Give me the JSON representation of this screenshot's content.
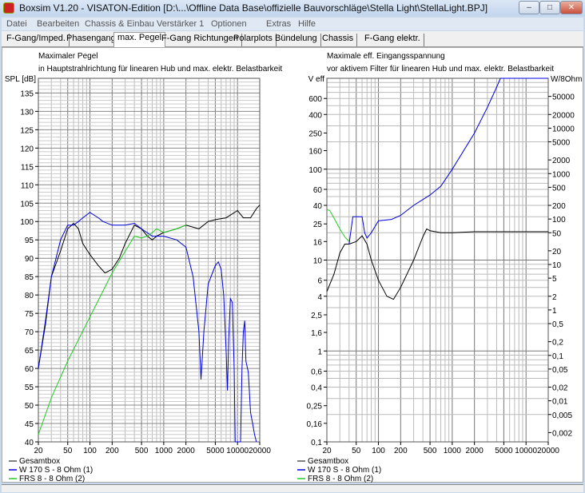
{
  "window": {
    "title": "Boxsim V1.20 - VISATON-Edition [D:\\...\\Offline Data Base\\offizielle Bauvorschläge\\Stella Light\\StellaLight.BPJ]",
    "min": "–",
    "max": "□",
    "close": "✕"
  },
  "menu": [
    "Datei",
    "Bearbeiten",
    "Chassis & Einbau",
    "Verstärker 1",
    "Optionen",
    "Extras",
    "Hilfe"
  ],
  "tabs": [
    "F-Gang/Imped.",
    "Phasengang",
    "max. Pegel",
    "F-Gang Richtungen",
    "Polarplots",
    "Bündelung",
    "Chassis",
    "F-Gang elektr."
  ],
  "active_tab": "max. Pegel",
  "colors": {
    "gesamt": "#000000",
    "woofer": "#0000dd",
    "frs": "#22cc22"
  },
  "chart_data": [
    {
      "type": "line",
      "title": "Maximaler Pegel",
      "subtitle": "in Hauptstrahlrichtung für linearen Hub und max. elektr. Belastbarkeit",
      "ylabel": "SPL [dB]",
      "xscale": "log",
      "xlim": [
        20,
        20000
      ],
      "ylim": [
        40,
        139
      ],
      "xticks": [
        20,
        50,
        100,
        200,
        500,
        1000,
        2000,
        5000,
        10000,
        20000
      ],
      "yticks": [
        40,
        45,
        50,
        55,
        60,
        65,
        70,
        75,
        80,
        85,
        90,
        95,
        100,
        105,
        110,
        115,
        120,
        125,
        130,
        135
      ],
      "legend": [
        "Gesamtbox",
        "W 170 S - 8 Ohm (1)",
        "FRS 8 - 8 Ohm (2)"
      ],
      "series": [
        {
          "name": "Gesamtbox",
          "color": "#000000",
          "points": [
            [
              20,
              60
            ],
            [
              25,
              72
            ],
            [
              30,
              85
            ],
            [
              40,
              92
            ],
            [
              50,
              98
            ],
            [
              60,
              99.5
            ],
            [
              70,
              98
            ],
            [
              80,
              94
            ],
            [
              100,
              91
            ],
            [
              130,
              88
            ],
            [
              160,
              86
            ],
            [
              200,
              87
            ],
            [
              250,
              90
            ],
            [
              300,
              94
            ],
            [
              400,
              99
            ],
            [
              500,
              98
            ],
            [
              600,
              96
            ],
            [
              700,
              95
            ],
            [
              800,
              96
            ],
            [
              1000,
              97
            ],
            [
              1500,
              98
            ],
            [
              2000,
              99
            ],
            [
              3000,
              98
            ],
            [
              4000,
              100
            ],
            [
              5000,
              100.5
            ],
            [
              7000,
              101
            ],
            [
              10000,
              103
            ],
            [
              12000,
              101
            ],
            [
              15000,
              101
            ],
            [
              18000,
              103.5
            ],
            [
              20000,
              104.5
            ]
          ]
        },
        {
          "name": "W 170 S - 8 Ohm (1)",
          "color": "#0000dd",
          "points": [
            [
              20,
              60
            ],
            [
              25,
              73
            ],
            [
              30,
              85
            ],
            [
              40,
              95
            ],
            [
              50,
              99
            ],
            [
              60,
              99
            ],
            [
              70,
              100
            ],
            [
              80,
              101
            ],
            [
              100,
              102.5
            ],
            [
              130,
              101
            ],
            [
              150,
              100
            ],
            [
              200,
              99
            ],
            [
              300,
              99
            ],
            [
              400,
              99.5
            ],
            [
              500,
              98
            ],
            [
              700,
              96
            ],
            [
              1000,
              96
            ],
            [
              1500,
              95
            ],
            [
              2000,
              93
            ],
            [
              2500,
              85
            ],
            [
              3000,
              70
            ],
            [
              3200,
              57
            ],
            [
              3500,
              70
            ],
            [
              4000,
              83
            ],
            [
              5000,
              88
            ],
            [
              5500,
              89
            ],
            [
              6000,
              87
            ],
            [
              6500,
              80
            ],
            [
              7000,
              65
            ],
            [
              7300,
              54
            ],
            [
              7600,
              68
            ],
            [
              8000,
              79
            ],
            [
              8500,
              78
            ],
            [
              9000,
              60
            ],
            [
              9300,
              40
            ],
            [
              11000,
              40
            ],
            [
              11500,
              60
            ],
            [
              12000,
              70
            ],
            [
              12500,
              73
            ],
            [
              13000,
              62
            ],
            [
              14000,
              59
            ],
            [
              15000,
              48
            ],
            [
              16000,
              45
            ],
            [
              17000,
              42
            ],
            [
              18000,
              40
            ]
          ]
        },
        {
          "name": "FRS 8 - 8 Ohm (2)",
          "color": "#22cc22",
          "points": [
            [
              20,
              42
            ],
            [
              30,
              52
            ],
            [
              50,
              62
            ],
            [
              100,
              74
            ],
            [
              200,
              86
            ],
            [
              400,
              96
            ],
            [
              500,
              95.5
            ],
            [
              600,
              96
            ],
            [
              700,
              97
            ],
            [
              800,
              98
            ],
            [
              1000,
              97
            ],
            [
              1500,
              98
            ],
            [
              2000,
              99
            ]
          ]
        }
      ]
    },
    {
      "type": "line",
      "title": "Maximale eff. Eingangsspannung",
      "subtitle": "vor aktivem Filter für linearen Hub und max. elektr. Belastbarkeit",
      "ylabel": "V eff",
      "y2label": "W/8Ohm",
      "xscale": "log",
      "yscale": "log",
      "xlim": [
        20,
        20000
      ],
      "ylim": [
        0.1,
        1000
      ],
      "xticks": [
        20,
        50,
        100,
        200,
        500,
        1000,
        2000,
        5000,
        10000,
        20000
      ],
      "yticks": [
        "600",
        "400",
        "250",
        "160",
        "100",
        "60",
        "40",
        "25",
        "16",
        "10",
        "6",
        "4",
        "2,5",
        "1,6",
        "1",
        "0,6",
        "0,4",
        "0,25",
        "0,16",
        "0,1"
      ],
      "y2ticks": [
        "50000",
        "20000",
        "10000",
        "5000",
        "2000",
        "1000",
        "500",
        "200",
        "100",
        "50",
        "20",
        "10",
        "5",
        "2",
        "1",
        "0,5",
        "0,2",
        "0,1",
        "0,05",
        "0,02",
        "0,01",
        "0,005",
        "0,002"
      ],
      "legend": [
        "Gesamtbox",
        "W 170 S - 8 Ohm (1)",
        "FRS 8 - 8 Ohm (2)"
      ],
      "series": [
        {
          "name": "FRS 8 - 8 Ohm (2)",
          "color": "#22cc22",
          "points": [
            [
              20,
              36
            ],
            [
              22,
              35
            ],
            [
              25,
              29
            ],
            [
              30,
              22
            ],
            [
              35,
              18
            ],
            [
              40,
              16
            ]
          ]
        },
        {
          "name": "Gesamtbox",
          "color": "#000000",
          "points": [
            [
              20,
              4.5
            ],
            [
              25,
              7
            ],
            [
              30,
              12
            ],
            [
              35,
              15
            ],
            [
              40,
              15
            ],
            [
              50,
              16
            ],
            [
              60,
              18.5
            ],
            [
              70,
              15
            ],
            [
              80,
              10
            ],
            [
              100,
              6
            ],
            [
              130,
              4
            ],
            [
              160,
              3.7
            ],
            [
              200,
              5
            ],
            [
              300,
              10
            ],
            [
              400,
              18
            ],
            [
              450,
              22
            ],
            [
              500,
              21
            ],
            [
              700,
              20
            ],
            [
              1000,
              20
            ],
            [
              2000,
              20.5
            ],
            [
              20000,
              20.5
            ]
          ]
        },
        {
          "name": "W 170 S - 8 Ohm (1)",
          "color": "#0000dd",
          "points": [
            [
              40,
              15
            ],
            [
              45,
              30
            ],
            [
              50,
              30
            ],
            [
              60,
              30
            ],
            [
              65,
              20
            ],
            [
              70,
              17.5
            ],
            [
              80,
              20
            ],
            [
              100,
              27
            ],
            [
              150,
              28
            ],
            [
              200,
              31
            ],
            [
              300,
              40
            ],
            [
              500,
              52
            ],
            [
              700,
              65
            ],
            [
              1000,
              100
            ],
            [
              2000,
              250
            ],
            [
              3000,
              480
            ],
            [
              4000,
              800
            ],
            [
              4500,
              1000
            ],
            [
              20000,
              1000
            ]
          ]
        }
      ]
    }
  ]
}
